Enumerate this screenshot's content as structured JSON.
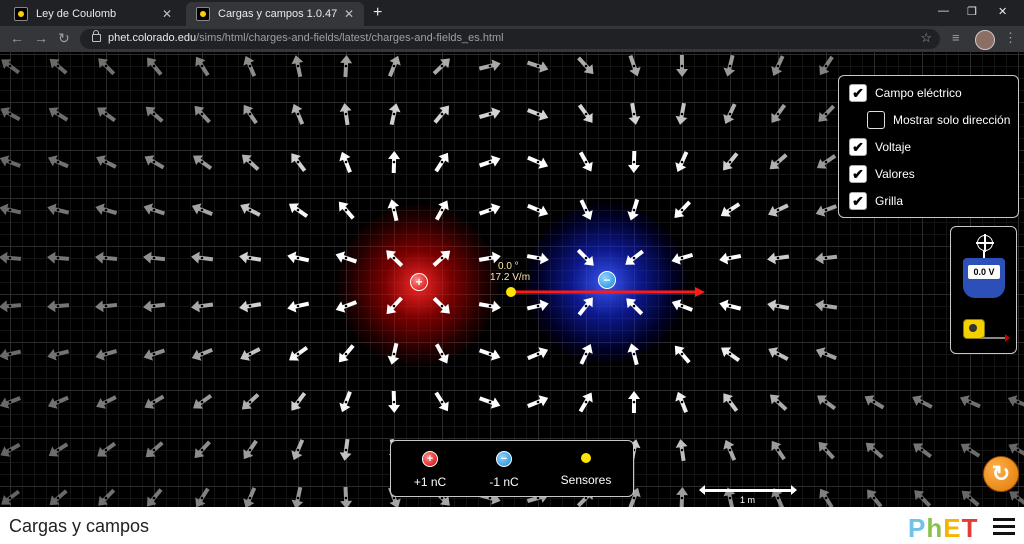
{
  "browser": {
    "tabs": [
      {
        "title": "Ley de Coulomb",
        "active": false
      },
      {
        "title": "Cargas y campos 1.0.47",
        "active": true
      }
    ],
    "url_host": "phet.colorado.edu",
    "url_path": "/sims/html/charges-and-fields/latest/charges-and-fields_es.html"
  },
  "controls": {
    "electric_field": {
      "label": "Campo eléctrico",
      "checked": true
    },
    "direction_only": {
      "label": "Mostrar solo dirección",
      "checked": false
    },
    "voltage": {
      "label": "Voltaje",
      "checked": true
    },
    "values": {
      "label": "Valores",
      "checked": true
    },
    "grid": {
      "label": "Grilla",
      "checked": true
    }
  },
  "sensor": {
    "angle": "0.0 °",
    "magnitude": "17.2 V/m"
  },
  "voltmeter": {
    "reading": "0.0 V"
  },
  "toolbox": {
    "positive_label": "+1 nC",
    "negative_label": "-1 nC",
    "sensors_label": "Sensores"
  },
  "scale": {
    "label": "1 m"
  },
  "footer": {
    "title": "Cargas y campos"
  },
  "colors": {
    "positive": "#d10000",
    "negative": "#1a88d6",
    "sensor": "#ffe600",
    "field_arrow": "#ff1a1a",
    "reset": "#f08a00"
  }
}
